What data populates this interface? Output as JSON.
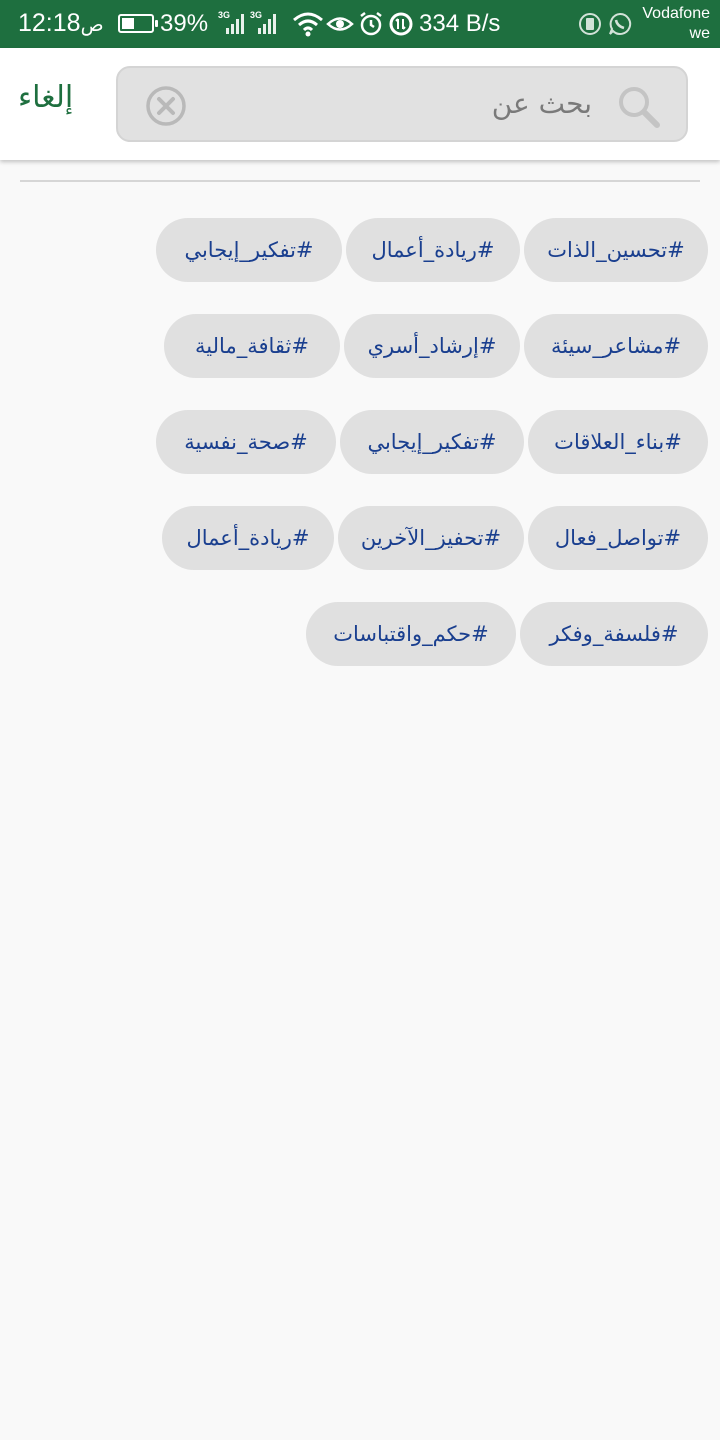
{
  "status_bar": {
    "time": "12:18",
    "ampm": "ص",
    "battery_percent": "39%",
    "battery_level": 0.39,
    "network_label_1": "3G",
    "network_label_2": "3G",
    "speed": "334 B/s",
    "carrier_line1": "Vodafone",
    "carrier_line2": "we",
    "icons": [
      "battery-icon",
      "signal-3g-icon",
      "signal-3g-icon",
      "wifi-icon",
      "eye-icon",
      "alarm-icon",
      "data-saver-icon",
      "sim-icon",
      "whatsapp-icon"
    ]
  },
  "header": {
    "cancel_label": "إلغاء",
    "search_placeholder": "بحث عن",
    "search_value": "",
    "search_icon": "search-icon",
    "clear_icon": "clear-icon"
  },
  "colors": {
    "brand_green": "#1e6f3f",
    "chip_background": "#e0e0e0",
    "chip_text": "#1a3f8f"
  },
  "hashtag_rows": [
    [
      "#تحسين_الذات",
      "#ريادة_أعمال",
      "#تفكير_إيجابي"
    ],
    [
      "#مشاعر_سيئة",
      "#إرشاد_أسري",
      "#ثقافة_مالية"
    ],
    [
      "#بناء_العلاقات",
      "#تفكير_إيجابي",
      "#صحة_نفسية"
    ],
    [
      "#تواصل_فعال",
      "#تحفيز_الآخرين",
      "#ريادة_أعمال"
    ],
    [
      "#فلسفة_وفكر",
      "#حكم_واقتباسات"
    ]
  ]
}
